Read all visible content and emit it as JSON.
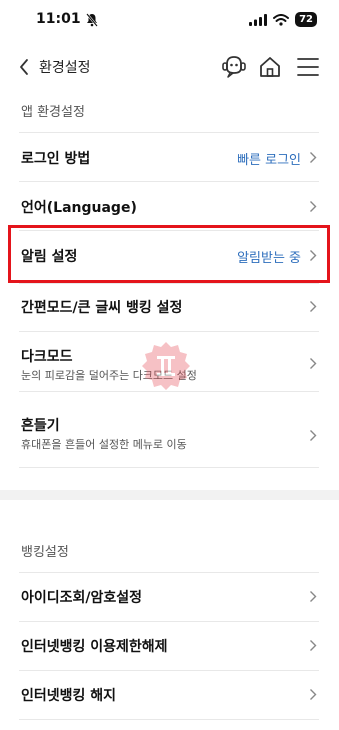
{
  "status_bar": {
    "time": "11:01",
    "battery": "72"
  },
  "header": {
    "title": "환경설정"
  },
  "section1": {
    "label": "앱 환경설정",
    "items": [
      {
        "label": "로그인 방법",
        "value": "빠른 로그인"
      },
      {
        "label": "언어(Language)"
      },
      {
        "label": "알림 설정",
        "value": "알림받는 중"
      },
      {
        "label": "간편모드/큰 글씨 뱅킹 설정"
      },
      {
        "label": "다크모드",
        "sub": "눈의 피로감을 덜어주는 다크모드 설정"
      },
      {
        "label": "흔들기",
        "sub": "휴대폰을 흔들어 설정한 메뉴로 이동"
      }
    ]
  },
  "section2": {
    "label": "뱅킹설정",
    "items": [
      {
        "label": "아이디조회/암호설정"
      },
      {
        "label": "인터넷뱅킹 이용제한해제"
      },
      {
        "label": "인터넷뱅킹 해지"
      }
    ]
  },
  "colors": {
    "link": "#2f6fbd",
    "highlight": "#e4141b",
    "watermark": "#e8505b"
  }
}
